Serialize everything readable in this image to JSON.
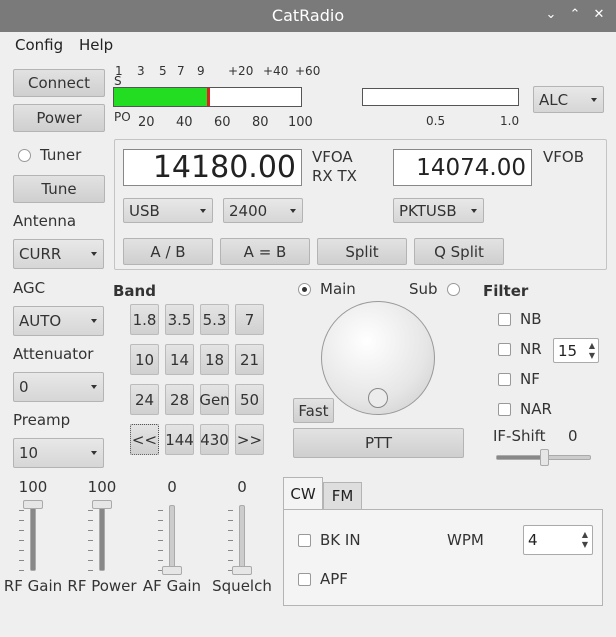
{
  "window": {
    "title": "CatRadio",
    "minimize": "⌄",
    "maximize": "⌃",
    "close": "✕"
  },
  "menu": {
    "config": "Config",
    "help": "Help"
  },
  "left": {
    "connect": "Connect",
    "power": "Power",
    "tuner": "Tuner",
    "tune": "Tune",
    "antenna_label": "Antenna",
    "antenna_value": "CURR",
    "agc_label": "AGC",
    "agc_value": "AUTO",
    "attenuator_label": "Attenuator",
    "attenuator_value": "0",
    "preamp_label": "Preamp",
    "preamp_value": "10"
  },
  "smeter": {
    "s_label": "S",
    "po_label": "PO",
    "top_ticks": [
      "1",
      "3",
      "5",
      "7",
      "9",
      "+20",
      "+40",
      "+60"
    ],
    "bottom_ticks": [
      "20",
      "40",
      "60",
      "80",
      "100"
    ],
    "level": 0.5
  },
  "submeter": {
    "ticks": [
      "0.5",
      "1.0"
    ],
    "level": 0,
    "mode": "ALC"
  },
  "vfo": {
    "vfoa_label": "VFOA",
    "rxtx_label": "RX TX",
    "vfoa_freq": "14180.00",
    "vfob_label": "VFOB",
    "vfob_freq": "14074.00",
    "mode_a": "USB",
    "bw_a": "2400",
    "mode_b": "PKTUSB",
    "ab": "A / B",
    "aeqb": "A = B",
    "split": "Split",
    "qsplit": "Q Split"
  },
  "band": {
    "title": "Band",
    "buttons": [
      "1.8",
      "3.5",
      "5.3",
      "7",
      "10",
      "14",
      "18",
      "21",
      "24",
      "28",
      "Gen",
      "50",
      "<<",
      "144",
      "430",
      ">>"
    ]
  },
  "tuning": {
    "main": "Main",
    "sub": "Sub",
    "fast": "Fast",
    "ptt": "PTT"
  },
  "filter": {
    "title": "Filter",
    "nb": "NB",
    "nr": "NR",
    "nr_value": "15",
    "nf": "NF",
    "nar": "NAR",
    "ifshift_label": "IF-Shift",
    "ifshift_value": "0",
    "ifshift_level": 0.5
  },
  "sliders": [
    {
      "label": "RF Gain",
      "value": "100",
      "level": 1.0
    },
    {
      "label": "RF Power",
      "value": "100",
      "level": 1.0
    },
    {
      "label": "AF Gain",
      "value": "0",
      "level": 0
    },
    {
      "label": "Squelch",
      "value": "0",
      "level": 0
    }
  ],
  "cw_tab": {
    "tab_cw": "CW",
    "tab_fm": "FM",
    "bkin": "BK IN",
    "apf": "APF",
    "wpm_label": "WPM",
    "wpm_value": "4"
  },
  "colors": {
    "meter_green": "#22dd22",
    "meter_peak": "#dd2222",
    "titlebar": "#7a7a7a"
  }
}
